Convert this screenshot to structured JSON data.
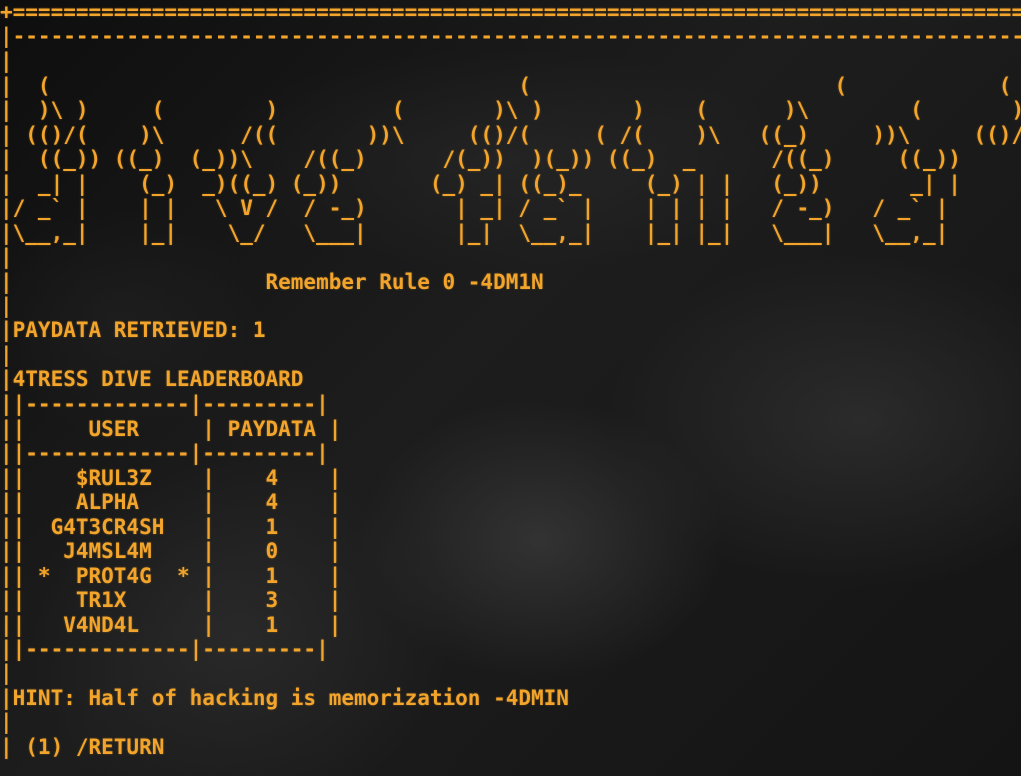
{
  "terminal": {
    "top_border": "+====================================================================================================",
    "dash_border": "|---------------------------------------------------------------------------------------------------",
    "banner_art": "|\n|  (                                     (                        (            (\n|  )\\ )     (        )         (       )\\ )       )    (      )\\        (       )\\ )\n| (()/(    )\\      /((       ))\\     (()/(     ( /(    )\\   ((_)     ))\\     (()/(\n|  ((_)) ((_)  (_))\\    /((_)      /(_))  )(_)) ((_)  _      /((_)     ((_))\n|  _| |    (_)  _)((_) (_))       (_) _| ((_)_     (_) | |   (_))       _| |\n|/ _` |    | |   \\ V /  / -_)       | _| / _` |    | | | |   / -_)   / _` |\n|\\__,_|    |_|    \\_/   \\___|       |_|  \\__,_|    |_| |_|   \\___|   \\__,_|\n|",
    "blank_line": "|",
    "rule_text": "|                    Remember Rule 0 -4DM1N",
    "paydata_retrieved": "|PAYDATA RETRIEVED: 1",
    "leaderboard_title": "|4TRESS DIVE LEADERBOARD",
    "leaderboard_table": "||-------------|---------|\n||     USER     | PAYDATA |\n||-------------|---------|\n||    $RUL3Z    |    4    |\n||    ALPHA     |    4    |\n||  G4T3CR4SH   |    1    |\n||   J4MSL4M    |    0    |\n|| *  PROT4G  * |    1    |\n||    TR1X      |    3    |\n||   V4ND4L     |    1    |\n||-------------|---------|",
    "hint": "|HINT: Half of hacking is memorization -4DMIN",
    "return_option": "| (1) /RETURN"
  },
  "leaderboard": {
    "title": "4TRESS DIVE LEADERBOARD",
    "columns": [
      "USER",
      "PAYDATA"
    ],
    "rows": [
      {
        "user": "$RUL3Z",
        "paydata": "4"
      },
      {
        "user": "ALPHA",
        "paydata": "4"
      },
      {
        "user": "G4T3CR4SH",
        "paydata": "1"
      },
      {
        "user": "J4MSL4M",
        "paydata": "0"
      },
      {
        "user": "PROT4G",
        "paydata": "1",
        "highlighted": true
      },
      {
        "user": "TR1X",
        "paydata": "3"
      },
      {
        "user": "V4ND4L",
        "paydata": "1"
      }
    ]
  },
  "colors": {
    "text": "#f2a42b",
    "background": "#161616"
  }
}
